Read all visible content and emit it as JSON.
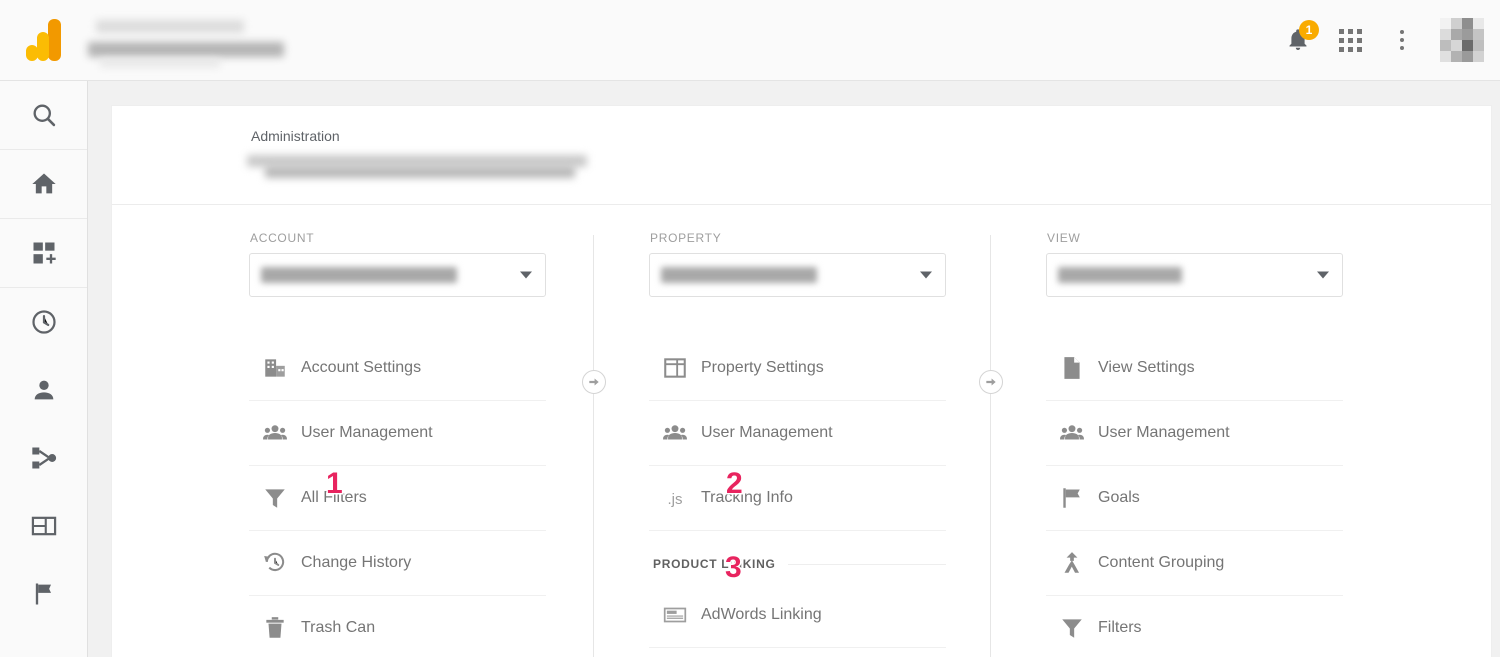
{
  "topbar": {
    "logo_name": "google-analytics-logo",
    "account_blurred": true,
    "notifications": {
      "icon": "bell-icon",
      "badge_count": "1",
      "badge_color": "#f9ab00"
    },
    "apps": {
      "icon": "apps-grid-icon"
    },
    "more": {
      "icon": "more-vertical-icon"
    },
    "avatar": {
      "icon": "user-avatar",
      "blurred": true
    }
  },
  "rail": {
    "items": [
      {
        "icon": "search-icon",
        "name": "sidebar-item-search"
      },
      {
        "icon": "home-icon",
        "name": "sidebar-item-home"
      },
      {
        "icon": "customization-icon",
        "name": "sidebar-item-customization"
      },
      {
        "icon": "clock-icon",
        "name": "sidebar-item-realtime"
      },
      {
        "icon": "person-icon",
        "name": "sidebar-item-audience"
      },
      {
        "icon": "share-icon",
        "name": "sidebar-item-acquisition"
      },
      {
        "icon": "layout-icon",
        "name": "sidebar-item-behavior"
      },
      {
        "icon": "flag-icon",
        "name": "sidebar-item-conversions"
      }
    ]
  },
  "header": {
    "title": "Administration",
    "breadcrumb_blurred": true
  },
  "markers": {
    "one": "1",
    "two": "2",
    "three": "3",
    "color": "#e8245f"
  },
  "columns": {
    "account": {
      "label": "ACCOUNT",
      "select_value_blurred": true,
      "items": [
        {
          "label": "Account Settings",
          "icon": "building-icon"
        },
        {
          "label": "User Management",
          "icon": "people-icon"
        },
        {
          "label": "All Filters",
          "icon": "funnel-icon"
        },
        {
          "label": "Change History",
          "icon": "history-icon"
        },
        {
          "label": "Trash Can",
          "icon": "trash-icon"
        }
      ]
    },
    "property": {
      "label": "PROPERTY",
      "select_value_blurred": true,
      "items": [
        {
          "label": "Property Settings",
          "icon": "page-layout-icon"
        },
        {
          "label": "User Management",
          "icon": "people-icon"
        },
        {
          "label": "Tracking Info",
          "icon": "js-icon"
        }
      ],
      "section": {
        "label": "PRODUCT LINKING"
      },
      "section_items": [
        {
          "label": "AdWords Linking",
          "icon": "ad-card-icon"
        }
      ]
    },
    "view": {
      "label": "VIEW",
      "select_value_blurred": true,
      "items": [
        {
          "label": "View Settings",
          "icon": "document-icon"
        },
        {
          "label": "User Management",
          "icon": "people-icon"
        },
        {
          "label": "Goals",
          "icon": "flag-icon"
        },
        {
          "label": "Content Grouping",
          "icon": "merge-icon"
        },
        {
          "label": "Filters",
          "icon": "funnel-icon"
        }
      ]
    }
  },
  "connectors": {
    "arrow_icon": "arrow-right-circle-icon",
    "count": 2
  }
}
